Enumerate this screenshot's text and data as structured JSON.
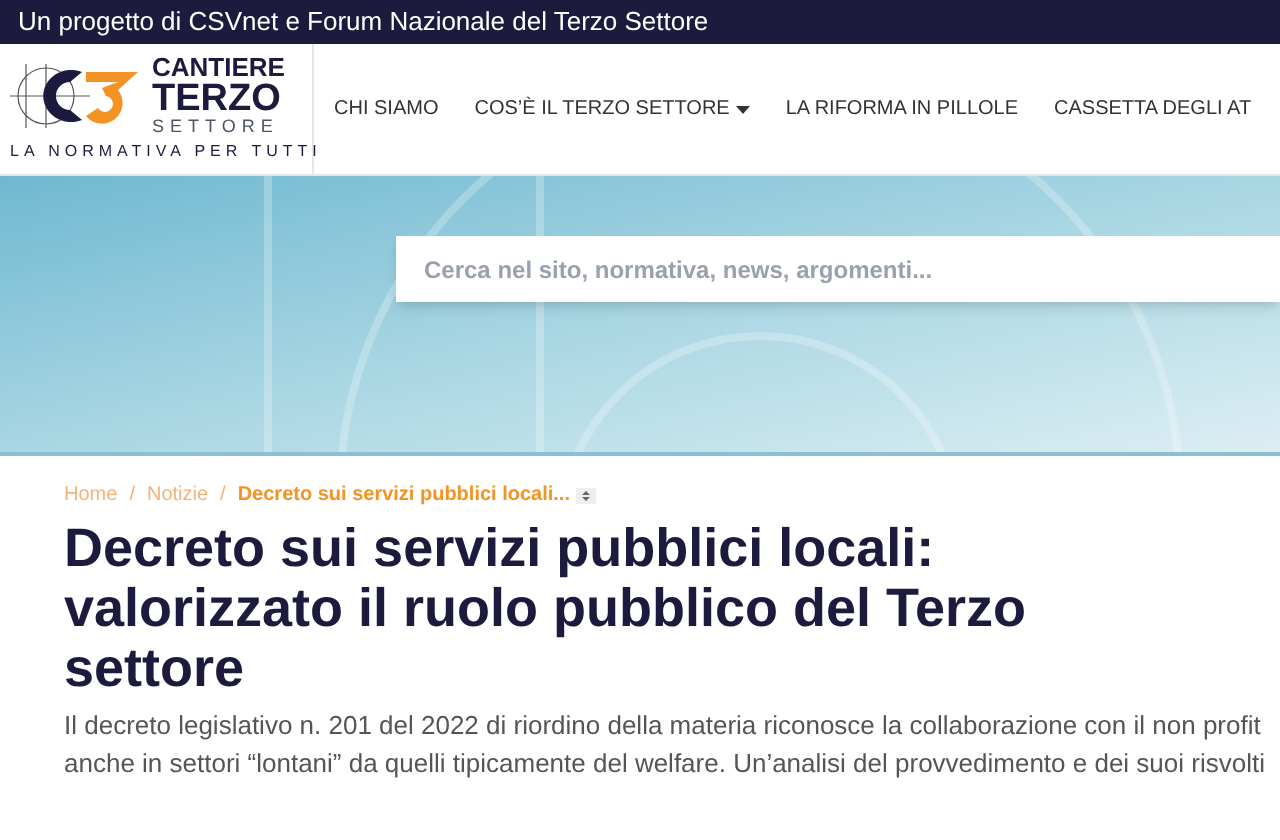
{
  "top_bar": {
    "text": "Un progetto di CSVnet e Forum Nazionale del Terzo Settore"
  },
  "logo": {
    "line_1": "CANTIERE",
    "line_2": "TERZO",
    "line_3": "SETTORE",
    "tagline": "LA NORMATIVA PER TUTTI"
  },
  "nav": {
    "items": [
      {
        "label": "CHI SIAMO",
        "dropdown": false
      },
      {
        "label": "COS’È IL TERZO SETTORE",
        "dropdown": true
      },
      {
        "label": "LA RIFORMA IN PILLOLE",
        "dropdown": false
      },
      {
        "label": "CASSETTA DEGLI AT",
        "dropdown": false
      }
    ]
  },
  "search": {
    "placeholder": "Cerca nel sito, normativa, news, argomenti..."
  },
  "breadcrumb_separator": "/",
  "breadcrumb": [
    {
      "label": "Home",
      "current": false
    },
    {
      "label": "Notizie",
      "current": false
    },
    {
      "label": "Decreto sui servizi pubblici locali...",
      "current": true
    }
  ],
  "article": {
    "title": "Decreto sui servizi pubblici locali: valorizzato il ruolo pubblico del Terzo settore",
    "summary": "Il decreto legislativo n. 201 del 2022 di riordino della materia riconosce la collaborazione con il non profit anche in settori “lontani” da quelli tipicamente del welfare. Un’analisi del provvedimento e dei suoi risvolti"
  }
}
